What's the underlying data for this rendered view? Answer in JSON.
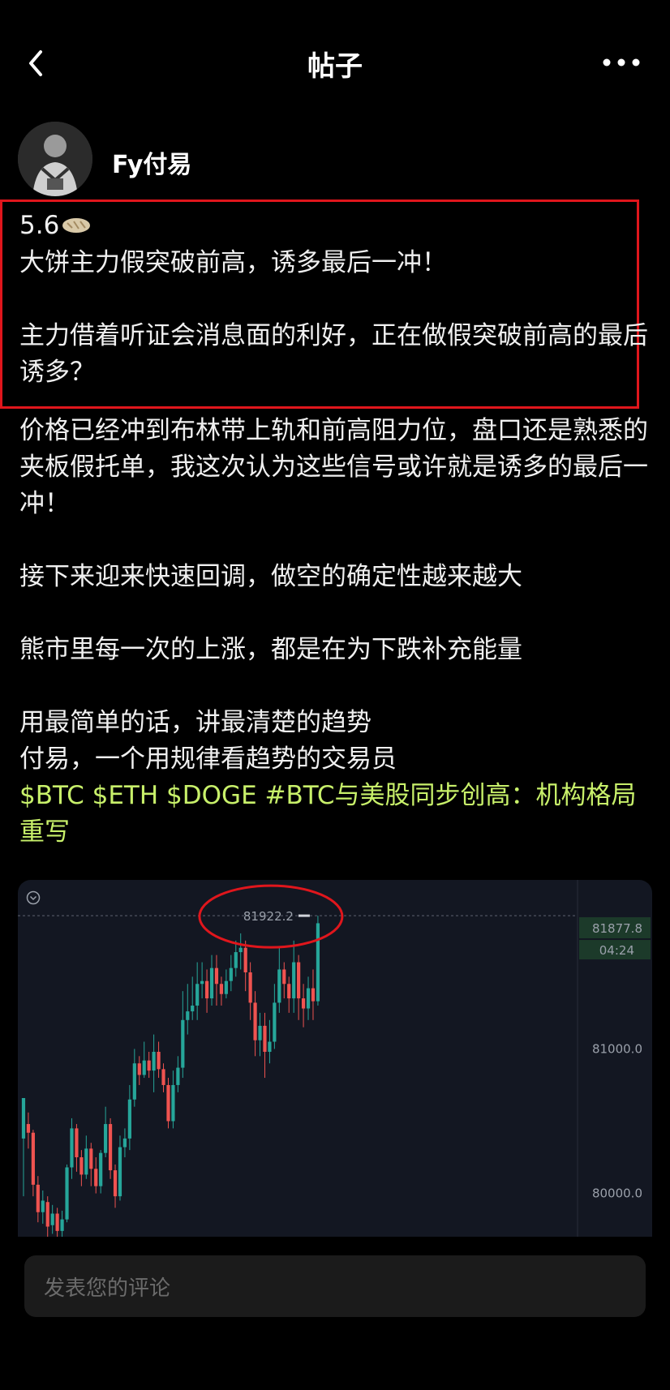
{
  "header": {
    "title": "帖子",
    "back_icon": "chevron-left-icon",
    "more_icon": "more-dots-icon"
  },
  "post": {
    "author": "Fy付易",
    "date_prefix": "5.6",
    "emoji": "flatbread-emoji",
    "paragraphs": [
      "大饼主力假突破前高，诱多最后一冲！",
      "",
      "主力借着听证会消息面的利好，正在做假突破前高的最后诱多？",
      "价格已经冲到布林带上轨和前高阻力位，盘口还是熟悉的夹板假托单，我这次认为这些信号或许就是诱多的最后一冲！",
      "",
      "接下来迎来快速回调，做空的确定性越来越大",
      "",
      "熊市里每一次的上涨，都是在为下跌补充能量",
      "",
      "用最简单的话，讲最清楚的趋势",
      "付易，一个用规律看趋势的交易员"
    ],
    "tags": [
      "$BTC",
      "$ETH",
      "$DOGE",
      "#BTC与美股同步创高：机构格局重写"
    ],
    "tag_color": "#c8f06a",
    "highlight_color": "#e0161c"
  },
  "chart_data": {
    "type": "candlestick",
    "y_ticks": [
      81000.0,
      80000.0
    ],
    "y_tick_labels": [
      "81000.0",
      "80000.0"
    ],
    "ylim": [
      79700,
      82170
    ],
    "high_marker": {
      "label": "81922.2",
      "value": 81922.2
    },
    "current_price": {
      "label": "81877.8",
      "value": 81877.8
    },
    "countdown": "04:24",
    "up_color": "#26a69a",
    "down_color": "#ef5350",
    "candles": [
      [
        80380,
        80660,
        79980,
        80500
      ],
      [
        80480,
        80420,
        80310,
        80560
      ],
      [
        80420,
        80060,
        79980,
        80440
      ],
      [
        80060,
        79870,
        79800,
        80120
      ],
      [
        79870,
        79950,
        79790,
        80020
      ],
      [
        79940,
        79770,
        79700,
        79980
      ],
      [
        79780,
        79860,
        79720,
        79920
      ],
      [
        79860,
        79740,
        79700,
        79900
      ],
      [
        79740,
        79820,
        79700,
        79880
      ],
      [
        79820,
        80180,
        79800,
        80200
      ],
      [
        80180,
        80450,
        80100,
        80520
      ],
      [
        80450,
        80250,
        80150,
        80480
      ],
      [
        80250,
        80130,
        80050,
        80300
      ],
      [
        80130,
        80310,
        80100,
        80400
      ],
      [
        80310,
        80170,
        80050,
        80350
      ],
      [
        80170,
        80050,
        80000,
        80250
      ],
      [
        80050,
        80280,
        80000,
        80300
      ],
      [
        80280,
        80480,
        80250,
        80600
      ],
      [
        80480,
        80160,
        80100,
        80520
      ],
      [
        80160,
        79980,
        79900,
        80200
      ],
      [
        79980,
        80320,
        79950,
        80400
      ],
      [
        80320,
        80380,
        80250,
        80450
      ],
      [
        80380,
        80650,
        80300,
        80750
      ],
      [
        80650,
        80900,
        80600,
        81000
      ],
      [
        80900,
        80820,
        80750,
        80950
      ],
      [
        80820,
        80920,
        80800,
        81050
      ],
      [
        80920,
        80850,
        80800,
        80980
      ],
      [
        80850,
        80980,
        80700,
        81100
      ],
      [
        80980,
        80860,
        80800,
        81050
      ],
      [
        80860,
        80750,
        80700,
        80900
      ],
      [
        80750,
        80500,
        80450,
        80800
      ],
      [
        80500,
        80750,
        80450,
        80850
      ],
      [
        80750,
        80870,
        80700,
        80950
      ],
      [
        80870,
        81200,
        80800,
        81400
      ],
      [
        81200,
        81260,
        81100,
        81450
      ],
      [
        81260,
        81300,
        81200,
        81500
      ],
      [
        81300,
        81450,
        81200,
        81600
      ],
      [
        81450,
        81470,
        81350,
        81600
      ],
      [
        81470,
        81350,
        81250,
        81550
      ],
      [
        81350,
        81560,
        81300,
        81650
      ],
      [
        81560,
        81450,
        81300,
        81650
      ],
      [
        81450,
        81380,
        81300,
        81500
      ],
      [
        81380,
        81470,
        81350,
        81550
      ],
      [
        81470,
        81560,
        81400,
        81650
      ],
      [
        81560,
        81670,
        81500,
        81750
      ],
      [
        81670,
        81700,
        81550,
        81800
      ],
      [
        81700,
        81530,
        81400,
        81750
      ],
      [
        81530,
        81320,
        81200,
        81600
      ],
      [
        81320,
        81060,
        80950,
        81400
      ],
      [
        81060,
        81160,
        80950,
        81250
      ],
      [
        81160,
        80980,
        80800,
        81250
      ],
      [
        80980,
        81050,
        80900,
        81200
      ],
      [
        81050,
        81320,
        81000,
        81450
      ],
      [
        81320,
        81550,
        81250,
        81700
      ],
      [
        81550,
        81450,
        81350,
        81600
      ],
      [
        81450,
        81350,
        81250,
        81500
      ],
      [
        81350,
        81600,
        81250,
        81750
      ],
      [
        81600,
        81350,
        81200,
        81650
      ],
      [
        81350,
        81280,
        81150,
        81450
      ],
      [
        81280,
        81420,
        81200,
        81500
      ],
      [
        81420,
        81330,
        81200,
        81550
      ],
      [
        81330,
        81870,
        81300,
        81922
      ]
    ]
  },
  "comment": {
    "placeholder": "发表您的评论"
  }
}
